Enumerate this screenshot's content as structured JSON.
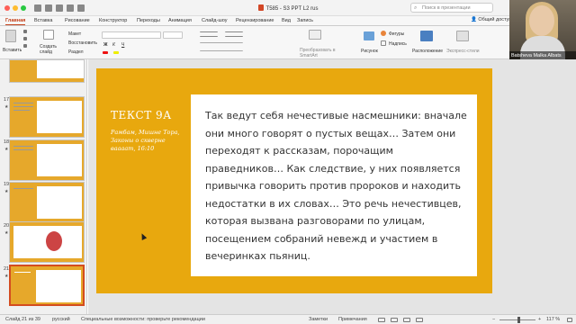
{
  "window": {
    "title": "T585 - S3 PPT L2 rus",
    "search_placeholder": "Поиск в презентации"
  },
  "ribbon": {
    "tabs": [
      "Главная",
      "Вставка",
      "Рисование",
      "Конструктор",
      "Переходы",
      "Анимация",
      "Слайд-шоу",
      "Рецензирование",
      "Вид",
      "Запись"
    ],
    "active_tab": "Главная",
    "share_label": "Общий доступ",
    "paste_label": "Вставить",
    "create_slide_label": "Создать слайд",
    "layout_label": "Макет",
    "reset_label": "Восстановить",
    "section_label": "Раздел",
    "smartart_label": "Преобразовать в SmartArt",
    "picture_label": "Рисунок",
    "shapes_label": "Фигуры",
    "textbox_label": "Надпись",
    "arrange_label": "Расположение",
    "quick_styles_label": "Экспресс-стили"
  },
  "participant": {
    "name": "Batsheva Malka Albats"
  },
  "thumbnails": [
    {
      "number": "",
      "starred": false,
      "selected": false
    },
    {
      "number": "17",
      "starred": true,
      "selected": false
    },
    {
      "number": "18",
      "starred": true,
      "selected": false
    },
    {
      "number": "19",
      "starred": true,
      "selected": false
    },
    {
      "number": "20",
      "starred": true,
      "selected": false
    },
    {
      "number": "21",
      "starred": true,
      "selected": true
    }
  ],
  "slide": {
    "title": "ТЕКСТ 9А",
    "subtitle": "Рамбам, Мишне Тора, Законы о скверне ваааат, 16:10",
    "body": "Так ведут себя нечестивые насмешники: вначале они много говорят о пустых вещах… Затем они переходят к рассказам, порочащим праведников… Как следствие, у них появляется привычка говорить против пророков и находить недостатки в их словах… Это речь нечестивцев, которая вызвана разговорами по улицам, посещением собраний невежд и участием в вечеринках пьяниц."
  },
  "status": {
    "slide_info": "Слайд 21 из 39",
    "language": "русский",
    "accessibility": "Специальные возможности: проверьте рекомендации",
    "notes_label": "Заметки",
    "comments_label": "Примечания",
    "zoom": "117 %"
  },
  "colors": {
    "slide_bg": "#e8a80e",
    "accent": "#c4401a"
  }
}
